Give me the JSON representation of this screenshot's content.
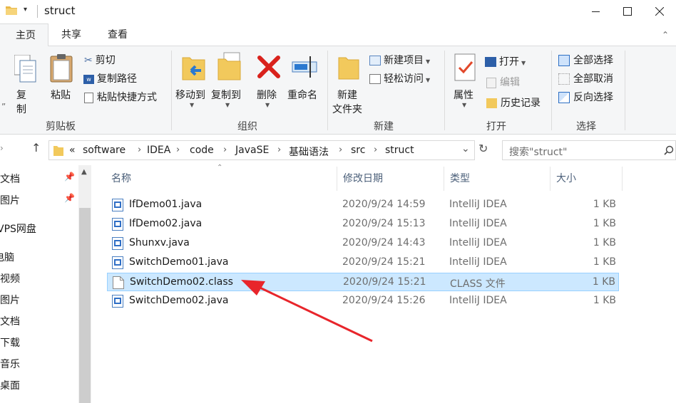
{
  "window": {
    "title": "struct"
  },
  "tabs": [
    {
      "label": "主页",
      "active": true
    },
    {
      "label": "共享",
      "active": false
    },
    {
      "label": "查看",
      "active": false
    }
  ],
  "ribbon": {
    "clipboard": {
      "group_label": "剪贴板",
      "copy_partial": "复制",
      "copy_icon_fragment": "”",
      "paste": "粘贴",
      "cut": "剪切",
      "copy_path": "复制路径",
      "paste_shortcut": "粘贴快捷方式"
    },
    "organize": {
      "group_label": "组织",
      "move_to": "移动到",
      "copy_to": "复制到",
      "delete": "删除",
      "rename": "重命名"
    },
    "new": {
      "group_label": "新建",
      "new_folder_line1": "新建",
      "new_folder_line2": "文件夹",
      "new_item": "新建项目",
      "easy_access": "轻松访问"
    },
    "open": {
      "group_label": "打开",
      "properties": "属性",
      "open": "打开",
      "edit": "编辑",
      "history": "历史记录"
    },
    "select": {
      "group_label": "选择",
      "select_all": "全部选择",
      "select_none": "全部取消",
      "invert": "反向选择"
    }
  },
  "address": {
    "prefix": "«",
    "crumbs": [
      "software",
      "IDEA",
      "code",
      "JavaSE",
      "基础语法",
      "src",
      "struct"
    ],
    "search_placeholder": "搜索\"struct\""
  },
  "nav": {
    "items": [
      "文档",
      "图片",
      "VPS网盘",
      "电脑",
      "视频",
      "图片",
      "文档",
      "下载",
      "音乐",
      "桌面"
    ]
  },
  "columns": {
    "name": "名称",
    "modified": "修改日期",
    "type": "类型",
    "size": "大小"
  },
  "files": [
    {
      "name": "IfDemo01.java",
      "modified": "2020/9/24 14:59",
      "type": "IntelliJ IDEA",
      "size": "1 KB",
      "kind": "java"
    },
    {
      "name": "IfDemo02.java",
      "modified": "2020/9/24 15:13",
      "type": "IntelliJ IDEA",
      "size": "1 KB",
      "kind": "java"
    },
    {
      "name": "Shunxv.java",
      "modified": "2020/9/24 14:43",
      "type": "IntelliJ IDEA",
      "size": "1 KB",
      "kind": "java"
    },
    {
      "name": "SwitchDemo01.java",
      "modified": "2020/9/24 15:21",
      "type": "IntelliJ IDEA",
      "size": "1 KB",
      "kind": "java"
    },
    {
      "name": "SwitchDemo02.class",
      "modified": "2020/9/24 15:21",
      "type": "CLASS 文件",
      "size": "1 KB",
      "kind": "class",
      "selected": true
    },
    {
      "name": "SwitchDemo02.java",
      "modified": "2020/9/24 15:26",
      "type": "IntelliJ IDEA",
      "size": "1 KB",
      "kind": "java"
    }
  ],
  "colors": {
    "selection_bg": "#cce8ff",
    "selection_border": "#99d1ff",
    "annotation_arrow": "#e8252b",
    "folder": "#f2c95c"
  }
}
